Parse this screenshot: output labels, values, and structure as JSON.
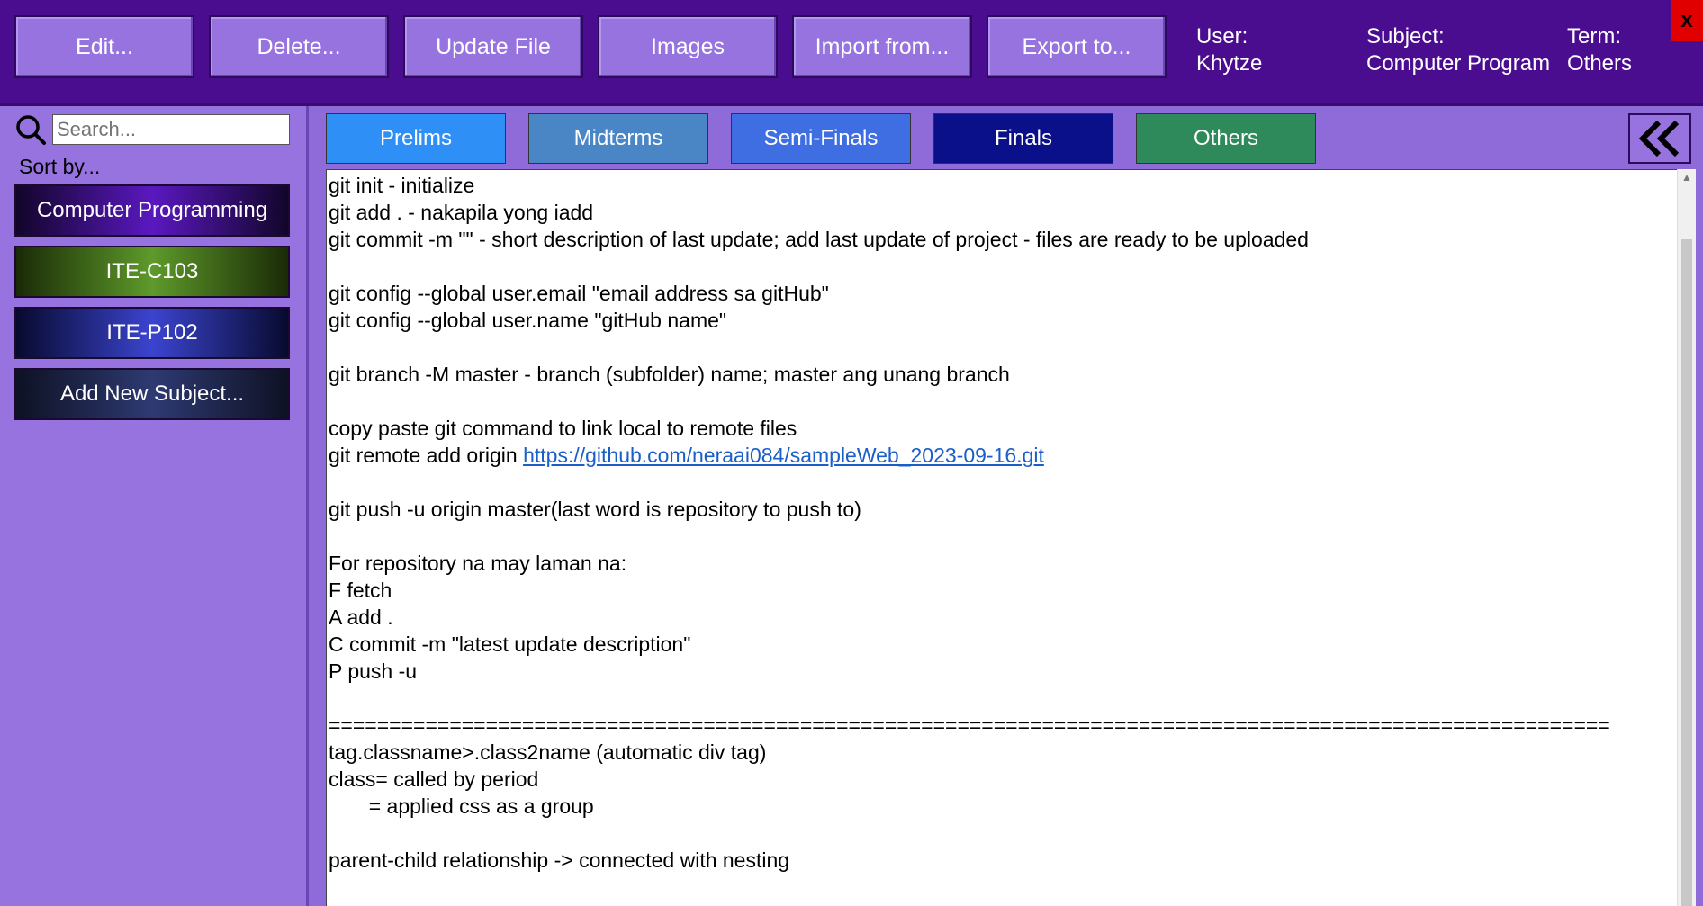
{
  "toolbar": {
    "edit": "Edit...",
    "delete": "Delete...",
    "update_file": "Update File",
    "images": "Images",
    "import_from": "Import from...",
    "export_to": "Export to..."
  },
  "info": {
    "user_label": "User:",
    "user_value": "Khytze",
    "subject_label": "Subject:",
    "subject_value": "Computer Program",
    "term_label": "Term:",
    "term_value": "Others"
  },
  "close": {
    "label": "x",
    "color": "#e00000"
  },
  "sidebar": {
    "search_placeholder": "Search...",
    "sort_label": "Sort by...",
    "subjects": [
      "Computer Programming",
      "ITE-C103",
      "ITE-P102"
    ],
    "add_subject": "Add New Subject..."
  },
  "tabs": [
    {
      "label": "Prelims",
      "color": "#2e8ff7"
    },
    {
      "label": "Midterms",
      "color": "#4a86c6"
    },
    {
      "label": "Semi-Finals",
      "color": "#3f6ee2"
    },
    {
      "label": "Finals",
      "color": "#0a0f8a"
    },
    {
      "label": "Others",
      "color": "#2e8a5a"
    }
  ],
  "content": {
    "lines": [
      "git init - initialize",
      "git add . - nakapila yong iadd",
      "git commit -m \"\" - short description of last update; add last update of project - files are ready to be uploaded",
      "",
      "git config --global user.email \"email address sa gitHub\"",
      "git config --global user.name \"gitHub name\"",
      "",
      "git branch -M master - branch (subfolder) name; master ang unang branch",
      "",
      "copy paste git command to link local to remote files",
      "git remote add origin ",
      "",
      "git push -u origin master(last word is repository to push to)",
      "",
      "For repository na may laman na:",
      "F fetch",
      "A add .",
      "C commit -m \"latest update description\"",
      "P push -u",
      "",
      "==========================================================================================================",
      "tag.classname>.class2name (automatic div tag)",
      "class= called by period",
      "       = applied css as a group",
      "",
      "parent-child relationship -> connected with nesting"
    ],
    "link": "https://github.com/neraai084/sampleWeb_2023-09-16.git"
  }
}
